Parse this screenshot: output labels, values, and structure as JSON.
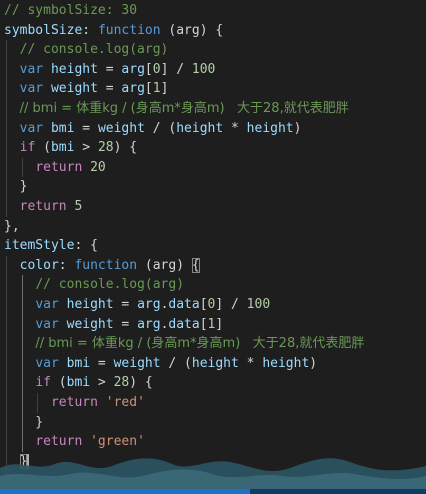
{
  "editor": {
    "lines": [
      [
        {
          "t": "// symbolSize: 30",
          "c": "comment"
        }
      ],
      [
        {
          "t": "symbolSize",
          "c": "prop"
        },
        {
          "t": ": ",
          "c": "punct"
        },
        {
          "t": "function",
          "c": "keyword"
        },
        {
          "t": " (arg) {",
          "c": "punct"
        }
      ],
      [
        {
          "t": "  "
        },
        {
          "t": "// console.log(arg)",
          "c": "comment"
        }
      ],
      [
        {
          "t": "  "
        },
        {
          "t": "var",
          "c": "keyword"
        },
        {
          "t": " height",
          "c": "var"
        },
        {
          "t": " = ",
          "c": "punct"
        },
        {
          "t": "arg",
          "c": "var"
        },
        {
          "t": "[",
          "c": "punct"
        },
        {
          "t": "0",
          "c": "number"
        },
        {
          "t": "] / ",
          "c": "punct"
        },
        {
          "t": "100",
          "c": "number"
        }
      ],
      [
        {
          "t": "  "
        },
        {
          "t": "var",
          "c": "keyword"
        },
        {
          "t": " weight",
          "c": "var"
        },
        {
          "t": " = ",
          "c": "punct"
        },
        {
          "t": "arg",
          "c": "var"
        },
        {
          "t": "[",
          "c": "punct"
        },
        {
          "t": "1",
          "c": "number"
        },
        {
          "t": "]",
          "c": "punct"
        }
      ],
      [
        {
          "t": "  "
        },
        {
          "t": "// bmi = 体重kg / (身高m*身高m)   大于28,就代表肥胖",
          "c": "comment"
        }
      ],
      [
        {
          "t": "  "
        },
        {
          "t": "var",
          "c": "keyword"
        },
        {
          "t": " bmi",
          "c": "var"
        },
        {
          "t": " = ",
          "c": "punct"
        },
        {
          "t": "weight",
          "c": "var"
        },
        {
          "t": " / (",
          "c": "punct"
        },
        {
          "t": "height",
          "c": "var"
        },
        {
          "t": " * ",
          "c": "punct"
        },
        {
          "t": "height",
          "c": "var"
        },
        {
          "t": ")",
          "c": "punct"
        }
      ],
      [
        {
          "t": "  "
        },
        {
          "t": "if",
          "c": "control"
        },
        {
          "t": " (",
          "c": "punct"
        },
        {
          "t": "bmi",
          "c": "var"
        },
        {
          "t": " > ",
          "c": "punct"
        },
        {
          "t": "28",
          "c": "number"
        },
        {
          "t": ") {",
          "c": "punct"
        }
      ],
      [
        {
          "t": "    "
        },
        {
          "t": "return",
          "c": "control"
        },
        {
          "t": " ",
          "c": "punct"
        },
        {
          "t": "20",
          "c": "number"
        }
      ],
      [
        {
          "t": "  }",
          "c": "punct"
        }
      ],
      [
        {
          "t": "  "
        },
        {
          "t": "return",
          "c": "control"
        },
        {
          "t": " ",
          "c": "punct"
        },
        {
          "t": "5",
          "c": "number"
        }
      ],
      [
        {
          "t": "},",
          "c": "punct"
        }
      ],
      [
        {
          "t": "itemStyle",
          "c": "prop"
        },
        {
          "t": ": {",
          "c": "punct"
        }
      ],
      [
        {
          "t": "  "
        },
        {
          "t": "color",
          "c": "prop"
        },
        {
          "t": ": ",
          "c": "punct"
        },
        {
          "t": "function",
          "c": "keyword"
        },
        {
          "t": " (arg) ",
          "c": "punct"
        },
        {
          "t": "{",
          "c": "punct",
          "match": true
        }
      ],
      [
        {
          "t": "    "
        },
        {
          "t": "// console.log(arg)",
          "c": "comment"
        }
      ],
      [
        {
          "t": "    "
        },
        {
          "t": "var",
          "c": "keyword"
        },
        {
          "t": " height",
          "c": "var"
        },
        {
          "t": " = ",
          "c": "punct"
        },
        {
          "t": "arg",
          "c": "var"
        },
        {
          "t": ".",
          "c": "punct"
        },
        {
          "t": "data",
          "c": "var"
        },
        {
          "t": "[",
          "c": "punct"
        },
        {
          "t": "0",
          "c": "number"
        },
        {
          "t": "] / ",
          "c": "punct"
        },
        {
          "t": "100",
          "c": "number"
        }
      ],
      [
        {
          "t": "    "
        },
        {
          "t": "var",
          "c": "keyword"
        },
        {
          "t": " weight",
          "c": "var"
        },
        {
          "t": " = ",
          "c": "punct"
        },
        {
          "t": "arg",
          "c": "var"
        },
        {
          "t": ".",
          "c": "punct"
        },
        {
          "t": "data",
          "c": "var"
        },
        {
          "t": "[",
          "c": "punct"
        },
        {
          "t": "1",
          "c": "number"
        },
        {
          "t": "]",
          "c": "punct"
        }
      ],
      [
        {
          "t": "    "
        },
        {
          "t": "// bmi = 体重kg / (身高m*身高m)   大于28,就代表肥胖",
          "c": "comment"
        }
      ],
      [
        {
          "t": "    "
        },
        {
          "t": "var",
          "c": "keyword"
        },
        {
          "t": " bmi",
          "c": "var"
        },
        {
          "t": " = ",
          "c": "punct"
        },
        {
          "t": "weight",
          "c": "var"
        },
        {
          "t": " / (",
          "c": "punct"
        },
        {
          "t": "height",
          "c": "var"
        },
        {
          "t": " * ",
          "c": "punct"
        },
        {
          "t": "height",
          "c": "var"
        },
        {
          "t": ")",
          "c": "punct"
        }
      ],
      [
        {
          "t": "    "
        },
        {
          "t": "if",
          "c": "control"
        },
        {
          "t": " (",
          "c": "punct"
        },
        {
          "t": "bmi",
          "c": "var"
        },
        {
          "t": " > ",
          "c": "punct"
        },
        {
          "t": "28",
          "c": "number"
        },
        {
          "t": ") {",
          "c": "punct"
        }
      ],
      [
        {
          "t": "      "
        },
        {
          "t": "return",
          "c": "control"
        },
        {
          "t": " ",
          "c": "punct"
        },
        {
          "t": "'red'",
          "c": "string"
        }
      ],
      [
        {
          "t": "    }",
          "c": "punct"
        }
      ],
      [
        {
          "t": "    "
        },
        {
          "t": "return",
          "c": "control"
        },
        {
          "t": " ",
          "c": "punct"
        },
        {
          "t": "'green'",
          "c": "string"
        }
      ],
      [
        {
          "t": "  "
        },
        {
          "t": "}",
          "c": "punct",
          "match": true,
          "cursor": true
        }
      ],
      [
        {
          "t": "}",
          "c": "punct"
        }
      ]
    ]
  },
  "colors": {
    "background": "#1e1e1e",
    "comment": "#6a9955",
    "keyword": "#569cd6",
    "control": "#c586c0",
    "variable": "#9cdcfe",
    "number": "#b5cea8",
    "string": "#ce9178",
    "scrollbar": "#1a73c7"
  }
}
